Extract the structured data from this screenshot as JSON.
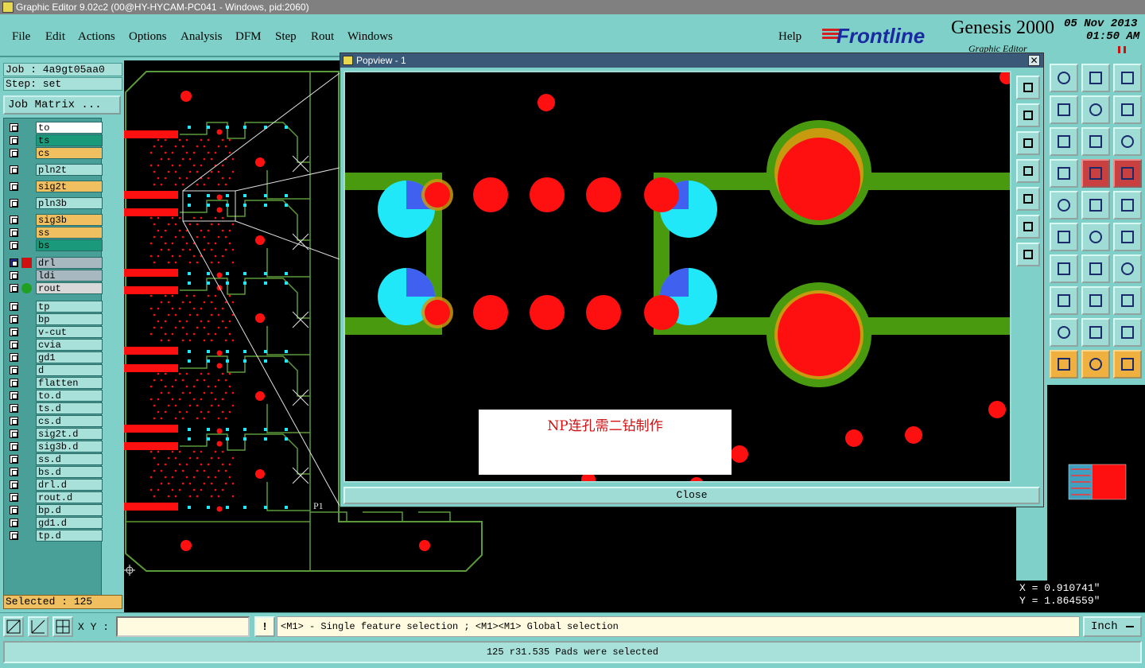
{
  "window": {
    "title": "Graphic Editor 9.02c2 (00@HY-HYCAM-PC041 - Windows, pid:2060)"
  },
  "menu": {
    "items": [
      "File",
      "Edit",
      "Actions",
      "Options",
      "Analysis",
      "DFM",
      "Step",
      "Rout",
      "Windows"
    ],
    "help": "Help"
  },
  "brand": {
    "logo": "Frontline",
    "product": "Genesis 2000",
    "subtitle": "Graphic Editor",
    "date": "05 Nov 2013",
    "time": "01:50 AM"
  },
  "job": {
    "job_line": "Job : 4a9gt05aa0",
    "step_line": "Step: set",
    "matrix_button": "Job Matrix ..."
  },
  "layers": [
    {
      "name": "to",
      "color": "#ffffff"
    },
    {
      "name": "ts",
      "color": "#1a9a7a"
    },
    {
      "name": "cs",
      "color": "#f0c060"
    },
    {
      "name": "pln2t",
      "color": "#a8e0da"
    },
    {
      "name": "sig2t",
      "color": "#f0c060"
    },
    {
      "name": "pln3b",
      "color": "#a8e0da"
    },
    {
      "name": "sig3b",
      "color": "#f0c060"
    },
    {
      "name": "ss",
      "color": "#f0c060"
    },
    {
      "name": "bs",
      "color": "#1a9a7a"
    },
    {
      "name": "drl",
      "color": "#a8b8c0"
    },
    {
      "name": "ldi",
      "color": "#a8b8c0"
    },
    {
      "name": "rout",
      "color": "#d8d8d8"
    },
    {
      "name": "tp",
      "color": "#a8e0da"
    },
    {
      "name": "bp",
      "color": "#a8e0da"
    },
    {
      "name": "v-cut",
      "color": "#a8e0da"
    },
    {
      "name": "cvia",
      "color": "#a8e0da"
    },
    {
      "name": "gd1",
      "color": "#a8e0da"
    },
    {
      "name": "d",
      "color": "#a8e0da"
    },
    {
      "name": "flatten",
      "color": "#a8e0da"
    },
    {
      "name": "to.d",
      "color": "#a8e0da"
    },
    {
      "name": "ts.d",
      "color": "#a8e0da"
    },
    {
      "name": "cs.d",
      "color": "#a8e0da"
    },
    {
      "name": "sig2t.d",
      "color": "#a8e0da"
    },
    {
      "name": "sig3b.d",
      "color": "#a8e0da"
    },
    {
      "name": "ss.d",
      "color": "#a8e0da"
    },
    {
      "name": "bs.d",
      "color": "#a8e0da"
    },
    {
      "name": "drl.d",
      "color": "#a8e0da"
    },
    {
      "name": "rout.d",
      "color": "#a8e0da"
    },
    {
      "name": "bp.d",
      "color": "#a8e0da"
    },
    {
      "name": "gd1.d",
      "color": "#a8e0da"
    },
    {
      "name": "tp.d",
      "color": "#a8e0da"
    }
  ],
  "selected": "Selected : 125",
  "popview": {
    "title": "Popview - 1",
    "note": "NP连孔需二钻制作",
    "close_button": "Close"
  },
  "coords": {
    "x": "X = 0.910741\"",
    "y": "Y = 1.864559\""
  },
  "command": {
    "xy_label": "X Y :",
    "xy_value": "",
    "hint": "<M1> - Single feature selection ; <M1><M1> Global selection",
    "units": "Inch"
  },
  "status": "125 r31.535 Pads were selected",
  "board_labels": {
    "p1": "P1"
  }
}
